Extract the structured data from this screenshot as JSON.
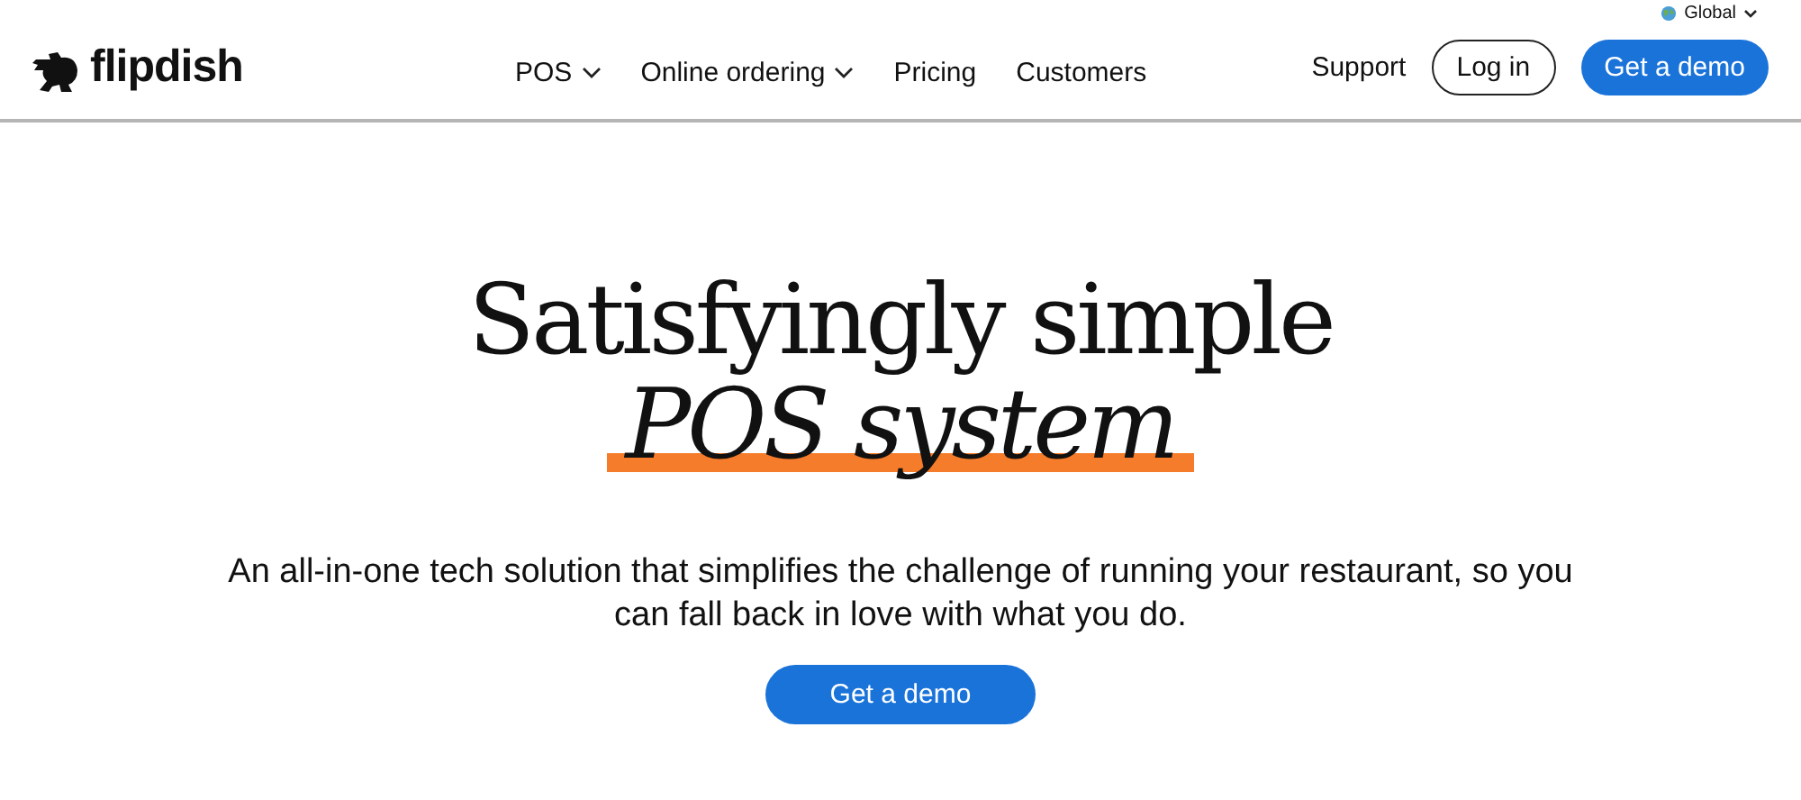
{
  "region": {
    "label": "Global"
  },
  "brand": {
    "name": "flipdish"
  },
  "nav": [
    {
      "label": "POS",
      "dropdown": true
    },
    {
      "label": "Online ordering",
      "dropdown": true
    },
    {
      "label": "Pricing",
      "dropdown": false
    },
    {
      "label": "Customers",
      "dropdown": false
    }
  ],
  "actions": [
    {
      "label": "Support",
      "kind": "link"
    },
    {
      "label": "Log in",
      "kind": "outline"
    },
    {
      "label": "Get a demo",
      "kind": "primary"
    }
  ],
  "hero": {
    "headline": "Satisfyingly simple",
    "highlight": "POS system",
    "text": "An all-in-one tech solution that simplifies the challenge of running your restaurant, so you can fall back in love with what you do.",
    "button": "Get a demo"
  }
}
